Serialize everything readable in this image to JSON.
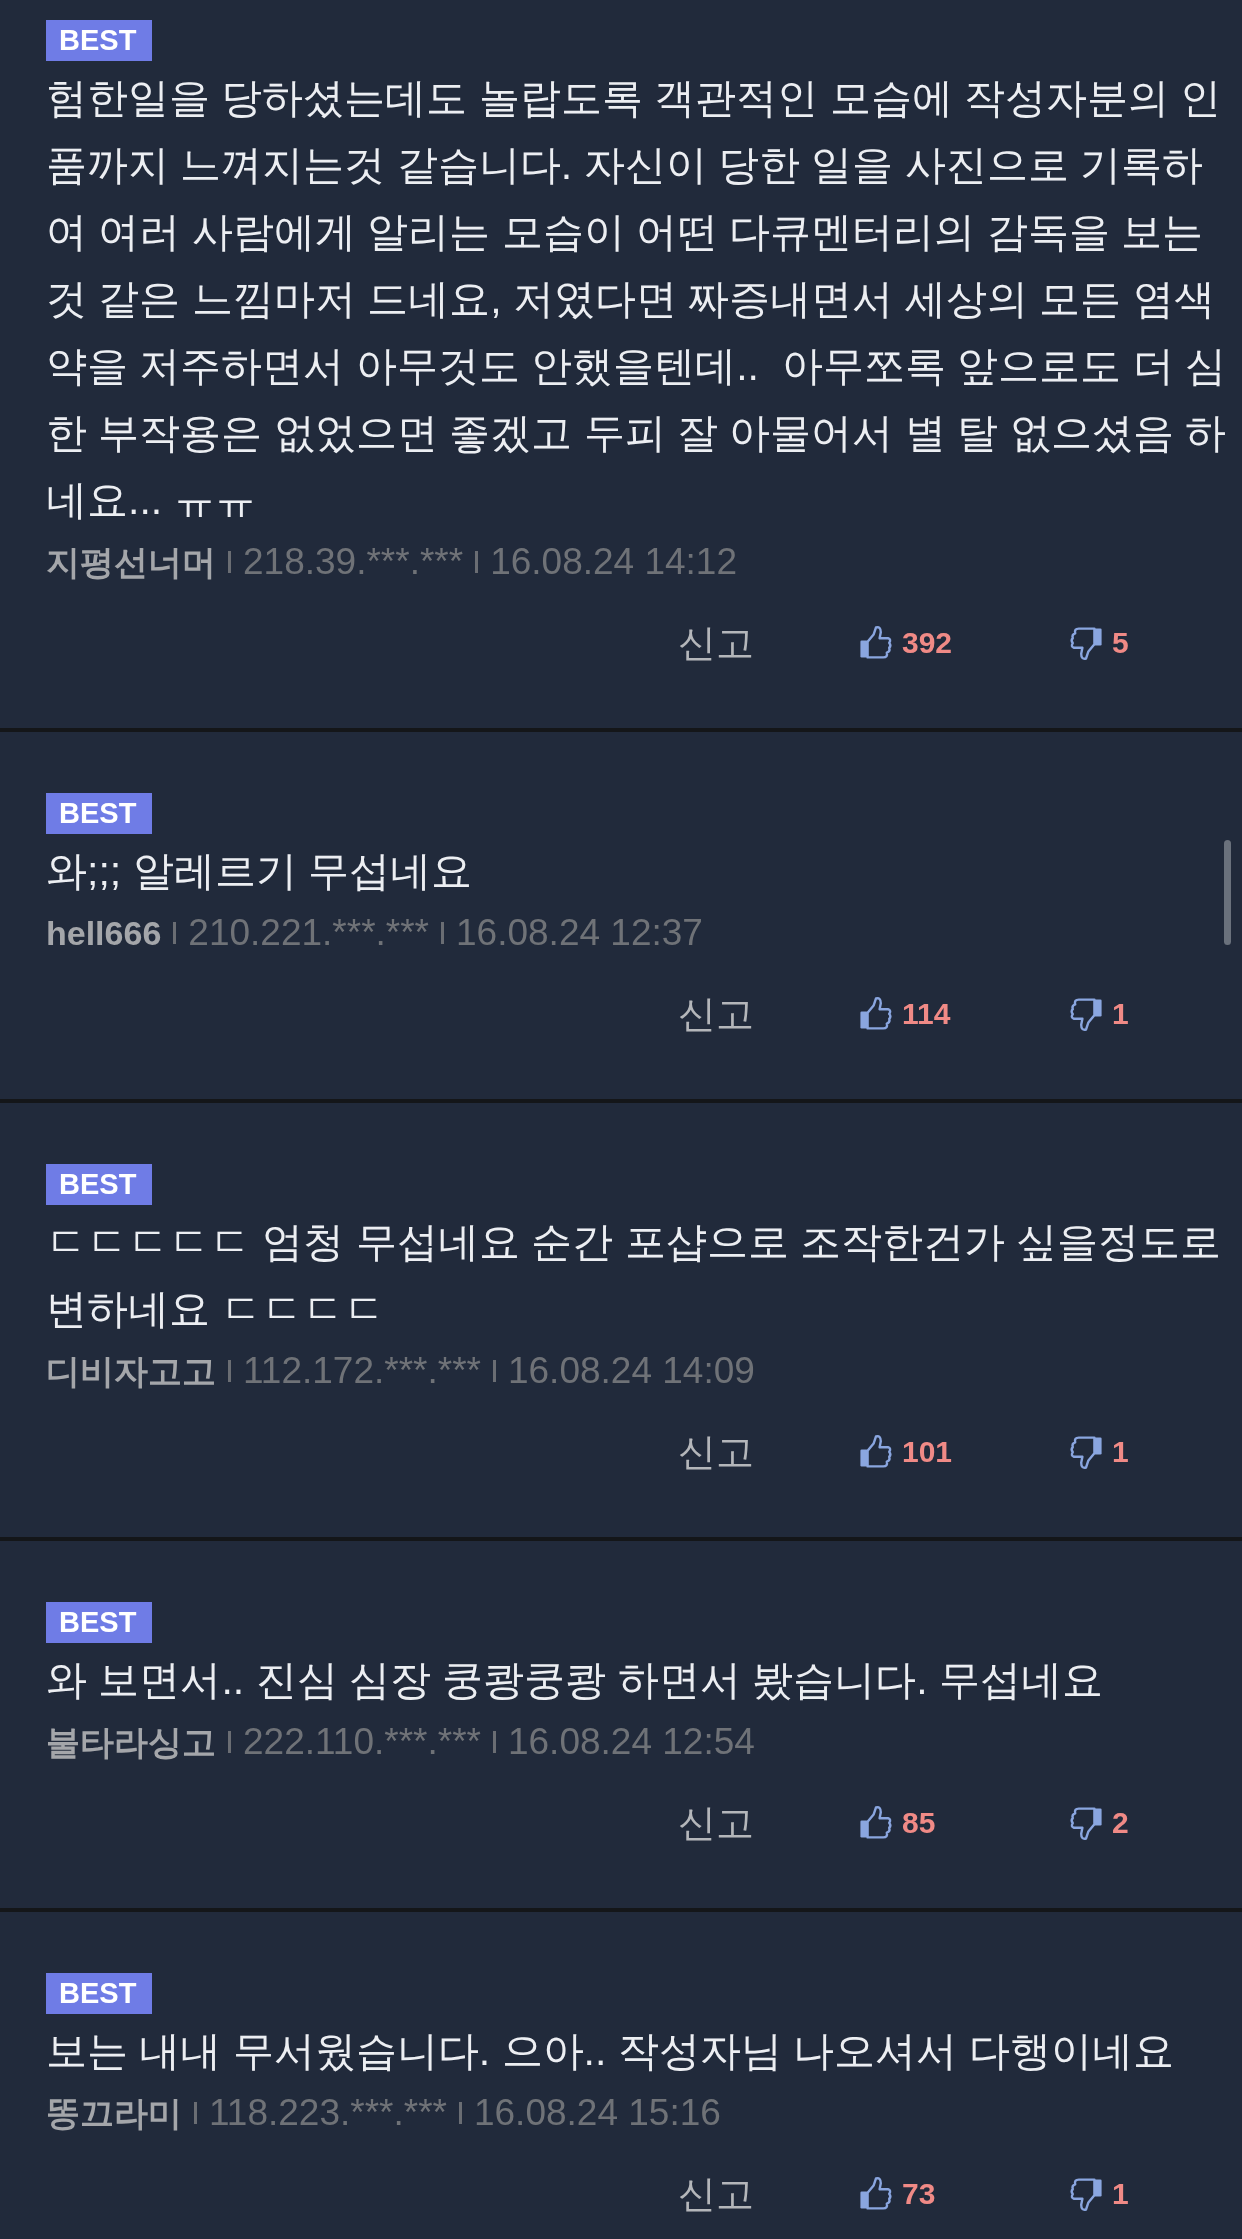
{
  "comments": [
    {
      "badge": "BEST",
      "text": "험한일을 당하셨는데도 놀랍도록 객관적인 모습에 작성자분의 인품까지 느껴지는것 같습니다. 자신이 당한 일을 사진으로 기록하여 여러 사람에게 알리는 모습이 어떤 다큐멘터리의 감독을 보는것 같은 느낌마저 드네요, 저였다면 짜증내면서 세상의 모든 염색약을 저주하면서 아무것도 안했을텐데..  아무쪼록 앞으로도 더 심한 부작용은 없었으면 좋겠고 두피 잘 아물어서 별 탈 없으셨음 하네요... ㅠㅠ",
      "author": "지평선너머",
      "ip": "218.39.***.***",
      "date": "16.08.24 14:12",
      "report": "신고",
      "likes": "392",
      "dislikes": "5"
    },
    {
      "badge": "BEST",
      "text": "와;;; 알레르기 무섭네요",
      "author": "hell666",
      "ip": "210.221.***.***",
      "date": "16.08.24 12:37",
      "report": "신고",
      "likes": "114",
      "dislikes": "1"
    },
    {
      "badge": "BEST",
      "text": "ㄷㄷㄷㄷㄷ 엄청 무섭네요 순간 포샵으로 조작한건가 싶을정도로 변하네요 ㄷㄷㄷㄷ",
      "author": "디비자고고",
      "ip": "112.172.***.***",
      "date": "16.08.24 14:09",
      "report": "신고",
      "likes": "101",
      "dislikes": "1"
    },
    {
      "badge": "BEST",
      "text": "와 보면서.. 진심 심장 쿵쾅쿵쾅 하면서 봤습니다. 무섭네요",
      "author": "불타라싱고",
      "ip": "222.110.***.***",
      "date": "16.08.24 12:54",
      "report": "신고",
      "likes": "85",
      "dislikes": "2"
    },
    {
      "badge": "BEST",
      "text": "보는 내내 무서웠습니다. 으아.. 작성자님 나오셔서 다행이네요",
      "author": "똥끄라미",
      "ip": "118.223.***.***",
      "date": "16.08.24 15:16",
      "report": "신고",
      "likes": "73",
      "dislikes": "1"
    }
  ]
}
